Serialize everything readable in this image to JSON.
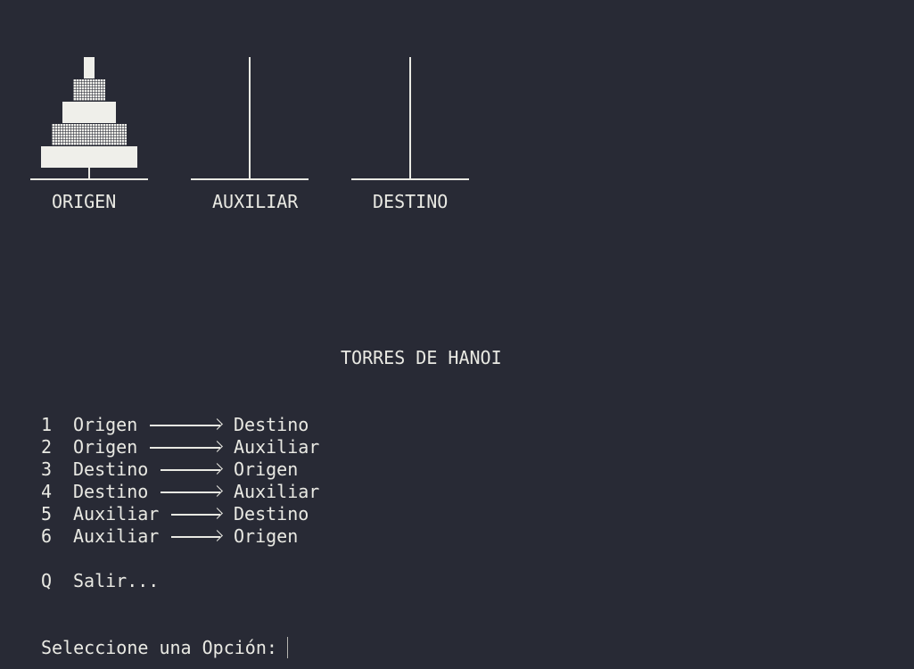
{
  "towers": {
    "origin_label": "ORIGEN",
    "aux_label": "AUXILIAR",
    "dest_label": "DESTINO",
    "origin_disk_count": 5,
    "aux_disk_count": 0,
    "dest_disk_count": 0
  },
  "title": "TORRES DE HANOI",
  "menu": [
    {
      "key": "1",
      "from": "Origen",
      "to": "Destino"
    },
    {
      "key": "2",
      "from": "Origen",
      "to": "Auxiliar"
    },
    {
      "key": "3",
      "from": "Destino",
      "to": "Origen"
    },
    {
      "key": "4",
      "from": "Destino",
      "to": "Auxiliar"
    },
    {
      "key": "5",
      "from": "Auxiliar",
      "to": "Destino"
    },
    {
      "key": "6",
      "from": "Auxiliar",
      "to": "Origen"
    }
  ],
  "quit": {
    "key": "Q",
    "label": "Salir..."
  },
  "prompt": {
    "label": "Seleccione una Opción:",
    "value": ""
  },
  "colors": {
    "background": "#282a35",
    "foreground": "#e9e9e3"
  }
}
